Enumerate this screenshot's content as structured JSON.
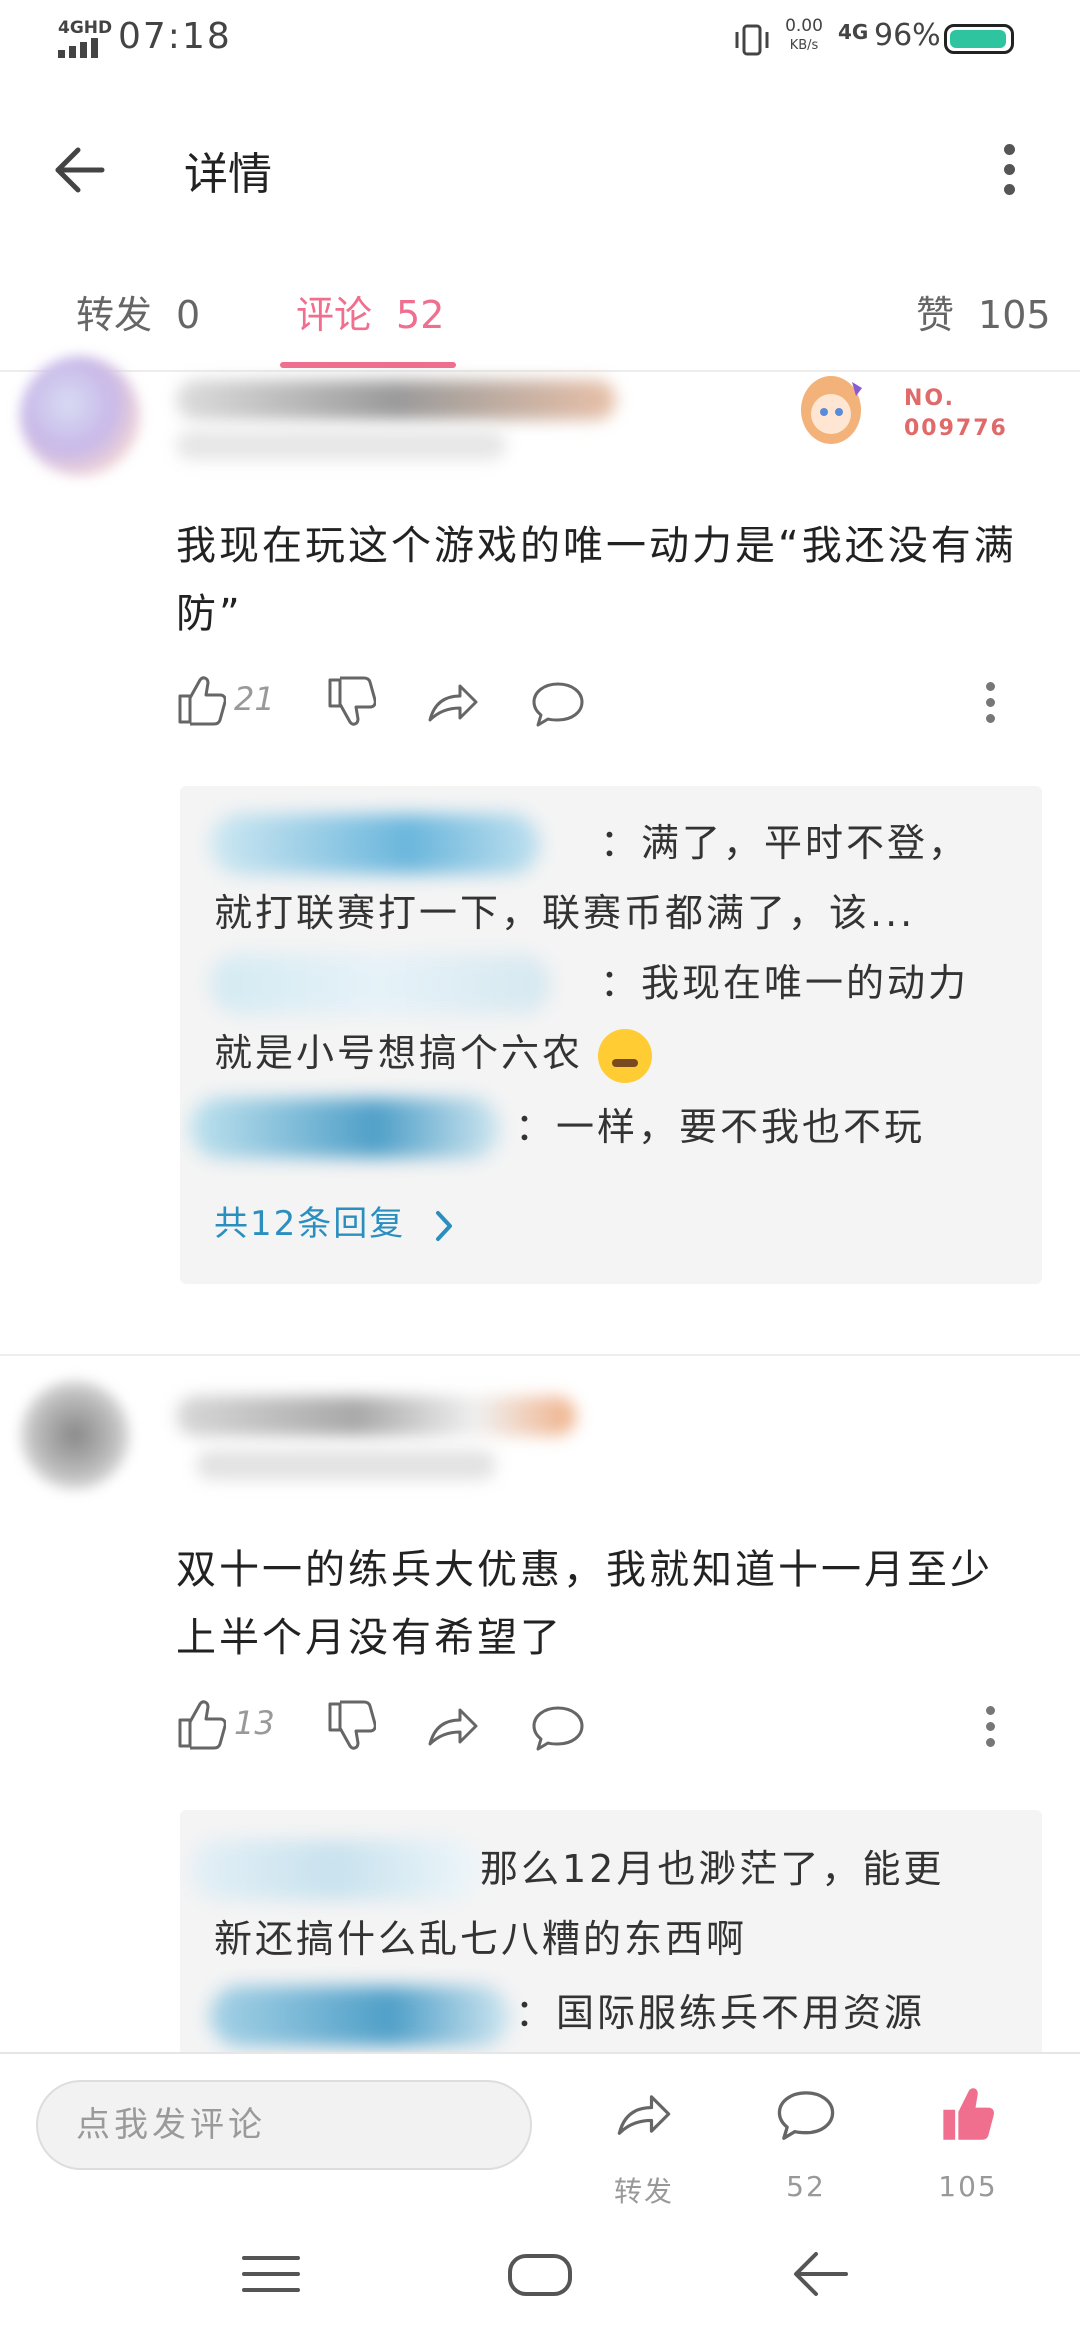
{
  "status_bar": {
    "network": "4GHD",
    "time": "07:18",
    "speed_value": "0.00",
    "speed_unit": "KB/s",
    "signal": "4G",
    "battery": "96%",
    "battery_level": 0.96,
    "battery_color": "#2ec4a0"
  },
  "header": {
    "title": "详情",
    "back_icon": "arrow-left-icon",
    "more_icon": "more-vertical-icon"
  },
  "tabs": [
    {
      "label": "转发",
      "count": "0"
    },
    {
      "label": "评论",
      "count": "52",
      "active": true
    },
    {
      "label": "赞",
      "count": "105"
    }
  ],
  "accent_color": "#f06e8e",
  "link_color": "#2a8fbf",
  "comments": [
    {
      "badge_text": "NO.\n009776",
      "text": "我现在玩这个游戏的唯一动力是“我还没有满防”",
      "likes": "21",
      "replies": [
        {
          "text": "：满了，平时不登，"
        },
        {
          "text": "就打联赛打一下，联赛币都满了，该..."
        },
        {
          "text": "：我现在唯一的动力"
        },
        {
          "text": "就是小号想搞个六农"
        },
        {
          "text": "：一样，要不我也不玩"
        }
      ],
      "more_replies": "共12条回复"
    },
    {
      "text": "双十一的练兵大优惠，我就知道十一月至少上半个月没有希望了",
      "likes": "13",
      "replies": [
        {
          "text": "那么12月也渺茫了，能更"
        },
        {
          "text": "新还搞什么乱七八糟的东西啊"
        },
        {
          "text": "：国际服练兵不用资源"
        }
      ]
    }
  ],
  "bottom_bar": {
    "input_placeholder": "点我发评论",
    "share_label": "转发",
    "comment_count": "52",
    "like_count": "105"
  }
}
